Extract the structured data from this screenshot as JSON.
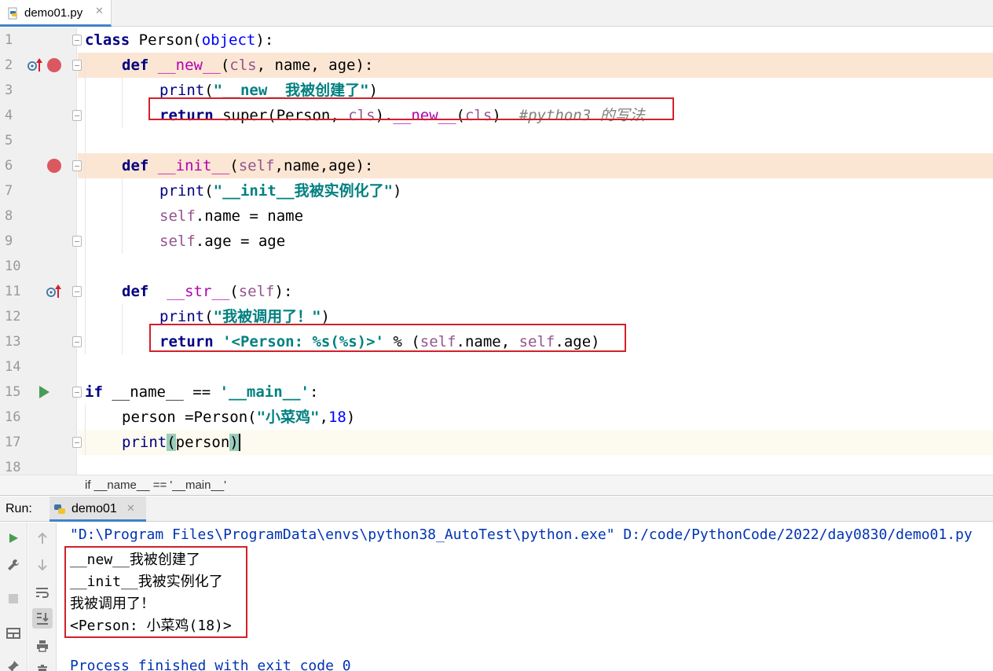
{
  "editor": {
    "tab": {
      "filename": "demo01.py"
    },
    "lines": [
      {
        "n": "1"
      },
      {
        "n": "2"
      },
      {
        "n": "3"
      },
      {
        "n": "4"
      },
      {
        "n": "5"
      },
      {
        "n": "6"
      },
      {
        "n": "7"
      },
      {
        "n": "8"
      },
      {
        "n": "9"
      },
      {
        "n": "10"
      },
      {
        "n": "11"
      },
      {
        "n": "12"
      },
      {
        "n": "13"
      },
      {
        "n": "14"
      },
      {
        "n": "15"
      },
      {
        "n": "16"
      },
      {
        "n": "17"
      },
      {
        "n": "18"
      }
    ],
    "tokens": {
      "l1": [
        "class",
        " Person",
        "(",
        "object",
        "):"
      ],
      "l2": [
        "def",
        " __new__",
        "(",
        "cls",
        ", name, age):"
      ],
      "l3": [
        "print",
        "(",
        "\"__new__我被创建了\"",
        ")"
      ],
      "l4": [
        "return",
        " super(Person, ",
        "cls",
        ").",
        "__new__",
        "(",
        "cls",
        ")  ",
        "#python3 的写法"
      ],
      "l6": [
        "def",
        " __init__",
        "(",
        "self",
        ",name,age):"
      ],
      "l7": [
        "print",
        "(",
        "\"__init__我被实例化了\"",
        ")"
      ],
      "l8": [
        "self",
        ".name = name"
      ],
      "l9": [
        "self",
        ".age = age"
      ],
      "l11": [
        "def",
        "  __str__",
        "(",
        "self",
        "):"
      ],
      "l12": [
        "print",
        "(",
        "\"我被调用了！\"",
        ")"
      ],
      "l13": [
        "return",
        " ",
        "'<Person: %s(%s)>'",
        " % (",
        "self",
        ".name, ",
        "self",
        ".age)"
      ],
      "l15": [
        "if",
        " __name__ == ",
        "'__main__'",
        ":"
      ],
      "l16": [
        "person =Person(",
        "\"小菜鸡\"",
        ",",
        "18",
        ")"
      ],
      "l17": [
        "print",
        "(",
        "person",
        ")"
      ]
    },
    "breadcrumb": "if __name__ == '__main__'"
  },
  "run": {
    "title": "Run:",
    "tab_label": "demo01",
    "output": {
      "command": "\"D:\\Program Files\\ProgramData\\envs\\python38_AutoTest\\python.exe\" D:/code/PythonCode/2022/day0830/demo01.py",
      "lines": [
        "__new__我被创建了",
        "__init__我被实例化了",
        "我被调用了！",
        "<Person: 小菜鸡(18)>"
      ],
      "exit": "Process finished with exit code 0"
    }
  },
  "colors": {
    "keyword": "#000080",
    "string": "#008080",
    "self": "#94558d",
    "dunder": "#b200b2",
    "comment": "#808080",
    "breakpoint_line": "#fbe6d4",
    "annotation_box": "#d3202a",
    "accent": "#4083c9"
  },
  "icons": {
    "file_tab": "python-file-icon",
    "breakpoint": "breakpoint-icon",
    "run_gutter": "run-arrow-icon",
    "override": "override-method-icon",
    "rerun": "rerun-icon",
    "settings": "wrench-icon",
    "stop": "stop-icon",
    "layout": "layout-icon",
    "pin": "pin-icon",
    "up": "arrow-up-icon",
    "down": "arrow-down-icon",
    "wrap": "soft-wrap-icon",
    "scroll": "scroll-to-end-icon",
    "print": "print-icon",
    "delete": "trash-icon"
  }
}
